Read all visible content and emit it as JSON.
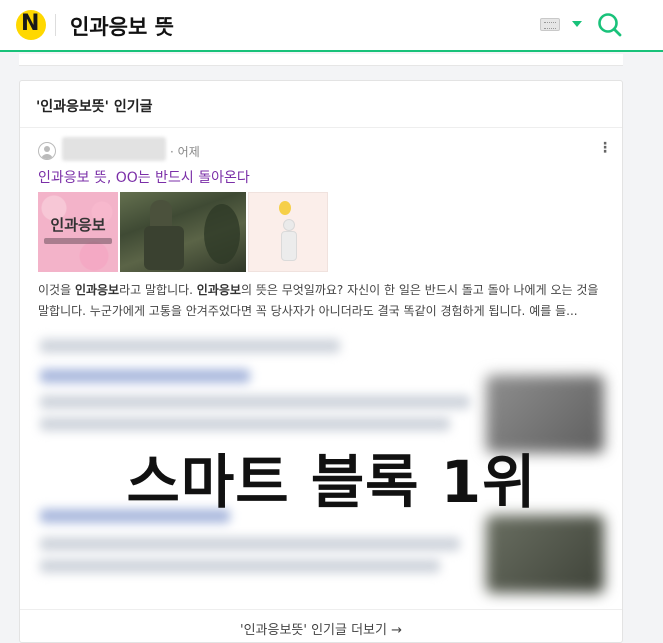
{
  "header": {
    "logo_letter": "N",
    "query": "인과응보 뜻",
    "accent_color": "#19c27a",
    "logo_color": "#ffd800",
    "icons": [
      "keyboard-icon",
      "chevron-down-icon",
      "search-icon"
    ]
  },
  "card": {
    "title": "'인과응보뜻' 인기글",
    "post": {
      "time": "어제",
      "title": "인과응보 뜻, OO는 반드시 돌아온다",
      "thumbnail_text": "인과응보",
      "excerpt_line1_pre": "이것을 ",
      "excerpt_line1_b1": "인과응보",
      "excerpt_line1_mid": "라고 말합니다. ",
      "excerpt_line1_b2": "인과응보",
      "excerpt_line1_post": "의 뜻은 무엇일까요? 자신이 한 일은 반드시 돌고 돌아 나에게 오는 것을 말합니다. 누군가에게 고통을 안겨주었다면 꼭 당사자가 아니더라도 결국 똑같이 경험하게 됩니다. 예를 들..."
    },
    "more_label": "'인과응보뜻' 인기글 더보기 →"
  },
  "overlay_text": "스마트 블록 1위"
}
